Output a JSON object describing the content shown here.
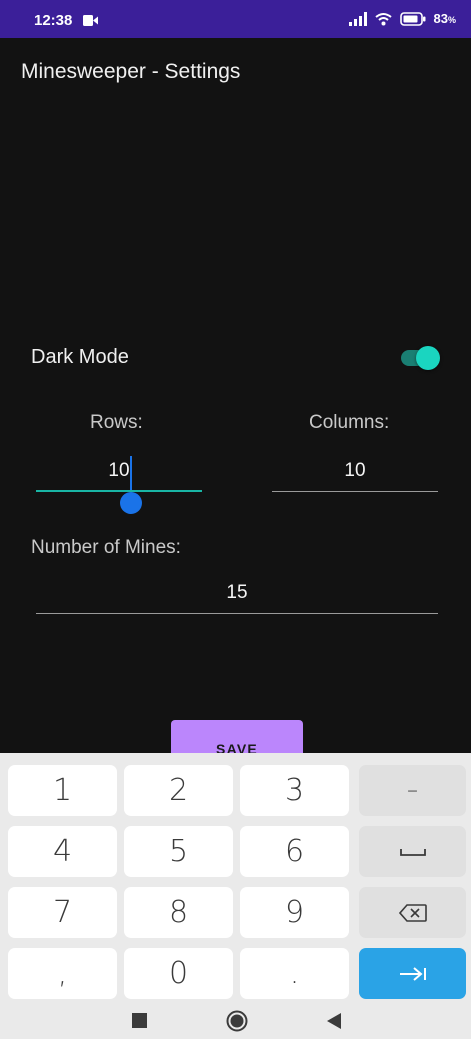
{
  "status_bar": {
    "time": "12:38",
    "battery": "83"
  },
  "app": {
    "title": "Minesweeper - Settings"
  },
  "settings": {
    "dark_mode_label": "Dark Mode",
    "dark_mode_on": true,
    "rows_label": "Rows:",
    "rows_value": "10",
    "columns_label": "Columns:",
    "columns_value": "10",
    "mines_label": "Number of Mines:",
    "mines_value": "15",
    "save_label": "SAVE"
  },
  "keyboard": {
    "keys": [
      "1",
      "2",
      "3",
      "–",
      "4",
      "5",
      "6",
      "",
      "7",
      "8",
      "9",
      "",
      ",",
      "0",
      ".",
      ""
    ],
    "special_icons": [
      "minus-key",
      "space-key-icon",
      "backspace-icon",
      "next-field-icon"
    ]
  },
  "colors": {
    "status_bar": "#3b1f99",
    "background": "#121212",
    "accent": "#1ad5c0",
    "save_button": "#bb86fc",
    "enter_key": "#2aa3e6"
  }
}
